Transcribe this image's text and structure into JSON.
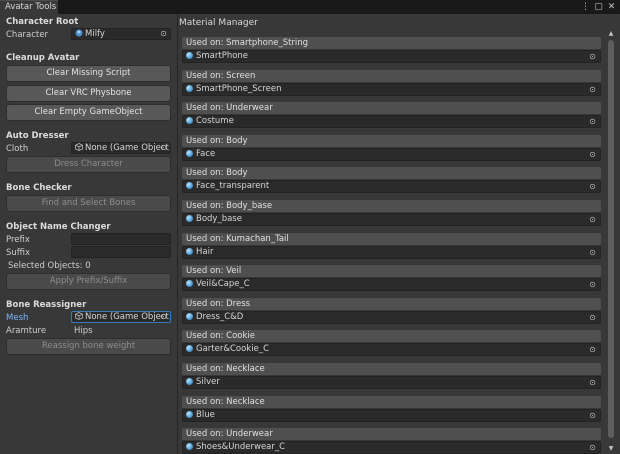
{
  "window": {
    "tab_title": "Avatar Tools",
    "icons": [
      "more-vertical-icon",
      "maximize-icon",
      "close-icon"
    ]
  },
  "left": {
    "character_root": {
      "header": "Character Root",
      "label": "Character",
      "value": "Milfy"
    },
    "cleanup": {
      "header": "Cleanup Avatar",
      "buttons": [
        "Clear Missing Script",
        "Clear VRC Physbone",
        "Clear Empty GameObject"
      ]
    },
    "auto_dresser": {
      "header": "Auto Dresser",
      "label": "Cloth",
      "value": "None (Game Object)",
      "button": "Dress Character"
    },
    "bone_checker": {
      "header": "Bone Checker",
      "button": "Find and Select Bones"
    },
    "object_name_changer": {
      "header": "Object Name Changer",
      "prefix_label": "Prefix",
      "prefix_value": "",
      "suffix_label": "Suffix",
      "suffix_value": "",
      "selected_text": "Selected Objects: 0",
      "button": "Apply Prefix/Suffix"
    },
    "bone_reassigner": {
      "header": "Bone Reassigner",
      "mesh_label": "Mesh",
      "mesh_value": "None (Game Object)",
      "armature_label": "Aramture",
      "armature_value": "Hips",
      "button": "Reassign bone weight"
    }
  },
  "material_manager": {
    "title": "Material Manager",
    "groups": [
      {
        "header": "Used on: Smartphone_String",
        "material": "SmartPhone"
      },
      {
        "header": "Used on: Screen",
        "material": "SmartPhone_Screen"
      },
      {
        "header": "Used on: Underwear",
        "material": "Costume"
      },
      {
        "header": "Used on: Body",
        "material": "Face"
      },
      {
        "header": "Used on: Body",
        "material": "Face_transparent"
      },
      {
        "header": "Used on: Body_base",
        "material": "Body_base"
      },
      {
        "header": "Used on: Kumachan_Tail",
        "material": "Hair"
      },
      {
        "header": "Used on: Veil",
        "material": "Veil&Cape_C"
      },
      {
        "header": "Used on: Dress",
        "material": "Dress_C&D"
      },
      {
        "header": "Used on: Cookie",
        "material": "Garter&Cookie_C"
      },
      {
        "header": "Used on: Necklace",
        "material": "Silver"
      },
      {
        "header": "Used on: Necklace",
        "material": "Blue"
      },
      {
        "header": "Used on: Underwear",
        "material": "Shoes&Underwear_C"
      }
    ]
  },
  "colors": {
    "accent_blue": "#7cb5ff",
    "selected_border": "#3a79bb"
  }
}
